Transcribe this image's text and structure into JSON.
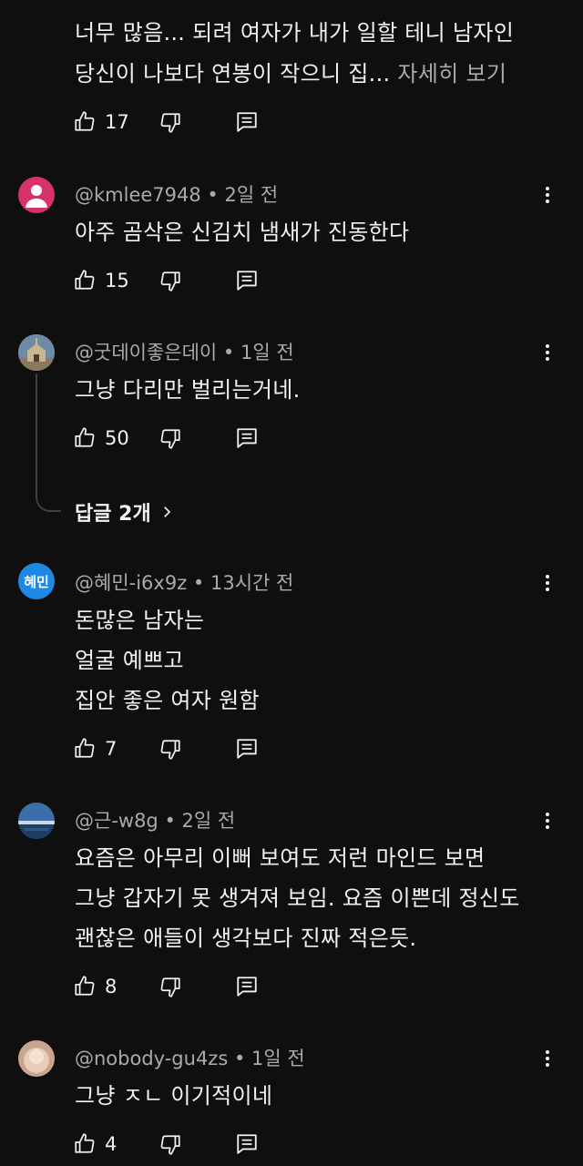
{
  "comments": [
    {
      "lines": [
        "너무 많음... 되려 여자가 내가 일할 테니 남자인",
        "당신이 나보다 연봉이 작으니 집..."
      ],
      "more_label": "자세히 보기",
      "likes": "17"
    },
    {
      "author": "@kmlee7948",
      "time": "2일 전",
      "lines": [
        "아주 곰삭은 신김치 냄새가 진동한다"
      ],
      "likes": "15",
      "avatar_color": "#d6336c"
    },
    {
      "author": "@굿데이좋은데이",
      "time": "1일 전",
      "lines": [
        "그냥 다리만 벌리는거네."
      ],
      "likes": "50",
      "replies_label": "답글 2개"
    },
    {
      "author": "@혜민-i6x9z",
      "time": "13시간 전",
      "lines": [
        "돈많은 남자는",
        "얼굴 예쁘고",
        "집안 좋은 여자 원함"
      ],
      "likes": "7",
      "avatar_text": "혜민",
      "avatar_color": "#1e88e5"
    },
    {
      "author": "@근-w8g",
      "time": "2일 전",
      "lines": [
        "요즘은 아무리 이뻐 보여도 저런 마인드 보면",
        "그냥 갑자기 못 생겨져 보임. 요즘 이쁜데 정신도",
        "괜찮은 애들이 생각보다 진짜 적은듯."
      ],
      "likes": "8"
    },
    {
      "author": "@nobody-gu4zs",
      "time": "1일 전",
      "lines": [
        "그냥 ㅈㄴ 이기적이네"
      ],
      "likes": "4"
    }
  ],
  "separator": " • "
}
